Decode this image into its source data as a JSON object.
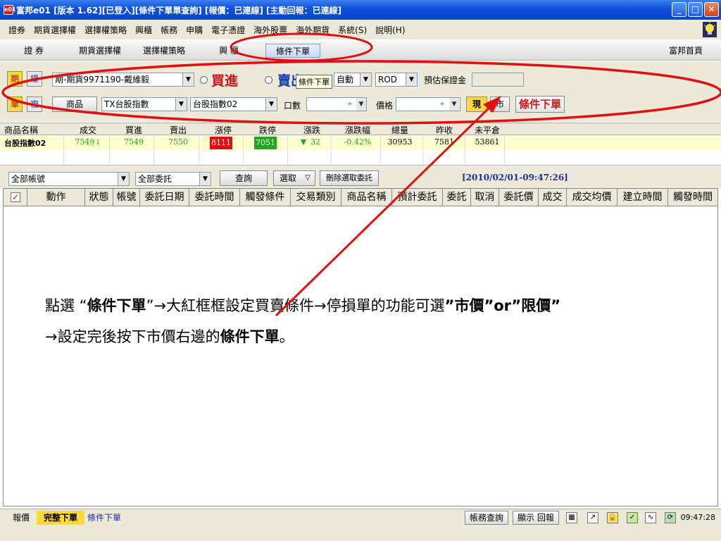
{
  "window": {
    "title": "富邦e01 [版本 1.62][已登入][條件下單單查詢] [報價：已連線] [主動回報：已連線]",
    "app_icon_text": "e01",
    "minimize": "_",
    "maximize": "□",
    "close": "✕"
  },
  "menu": [
    "證券",
    "期貨選擇權",
    "選擇權策略",
    "興櫃",
    "帳務",
    "申購",
    "電子憑證",
    "海外股票",
    "海外期貨",
    "系統(S)",
    "說明(H)"
  ],
  "nav": {
    "tabs": [
      "證 券",
      "期貨選擇權",
      "選擇權策略",
      "興 櫃",
      "條件下單"
    ],
    "home": "富邦首頁"
  },
  "order_panel": {
    "mode_left": "期",
    "mode_right": "權",
    "account": "期-期貨9971190-戴維毅",
    "buy": "買進",
    "sell": "賣出",
    "tooltip": "條件下單",
    "auto": "自動",
    "rod": "ROD",
    "margin_label": "預估保證金",
    "unit_left": "單",
    "unit_right": "複",
    "product_button": "商品",
    "product": "TX台股指數",
    "contract": "台股指數02",
    "qty_label": "口數",
    "price_label": "價格",
    "current_button": "現",
    "market_button": "市",
    "submit_button": "條件下單"
  },
  "quote": {
    "headers": [
      "商品名稱",
      "成交",
      "買進",
      "賣出",
      "漲停",
      "跌停",
      "漲跌",
      "漲跌幅",
      "總量",
      "昨收",
      "未平倉"
    ],
    "row": {
      "name": "台股指數02",
      "last": "7549↓",
      "bid": "7549",
      "ask": "7550",
      "limit_up": "8111",
      "limit_down": "7051",
      "change": "32",
      "change_pct": "-0.42%",
      "volume": "30953",
      "prev_close": "7581",
      "open_interest": "53861"
    }
  },
  "filter": {
    "account": "全部帳號",
    "orders": "全部委託",
    "query": "查詢",
    "select": "選取",
    "delete": "刪除選取委託",
    "timestamp": "[2010/02/01-09:47:26]"
  },
  "order_table": {
    "headers": [
      "動作",
      "狀態",
      "帳號",
      "委託日期",
      "委託時間",
      "觸發條件",
      "交易類別",
      "商品名稱",
      "預計委託",
      "委託",
      "取消",
      "委託價",
      "成交",
      "成交均價",
      "建立時間",
      "觸發時間"
    ]
  },
  "instructions": {
    "l1_a": "點選 “",
    "l1_b": "條件下單",
    "l1_c": "”→大紅框框設定買賣條件→停損單的功能可選",
    "l1_d": "”市價”or”限價”",
    "l2_a": "→設定完後按下市價右邊的",
    "l2_b": "條件下單",
    "l2_c": "。"
  },
  "status": {
    "tab_quote": "報價",
    "tab_full": "完整下單",
    "tab_cond": "條件下單",
    "btn_account": "帳務查詢",
    "btn_report": "顯示 回報",
    "clock": "09:47:28"
  },
  "colors": {
    "annotation": "#e01010",
    "title_bar": "#0b4fd8",
    "limit_up": "#e01010",
    "limit_down": "#1fa81f"
  }
}
